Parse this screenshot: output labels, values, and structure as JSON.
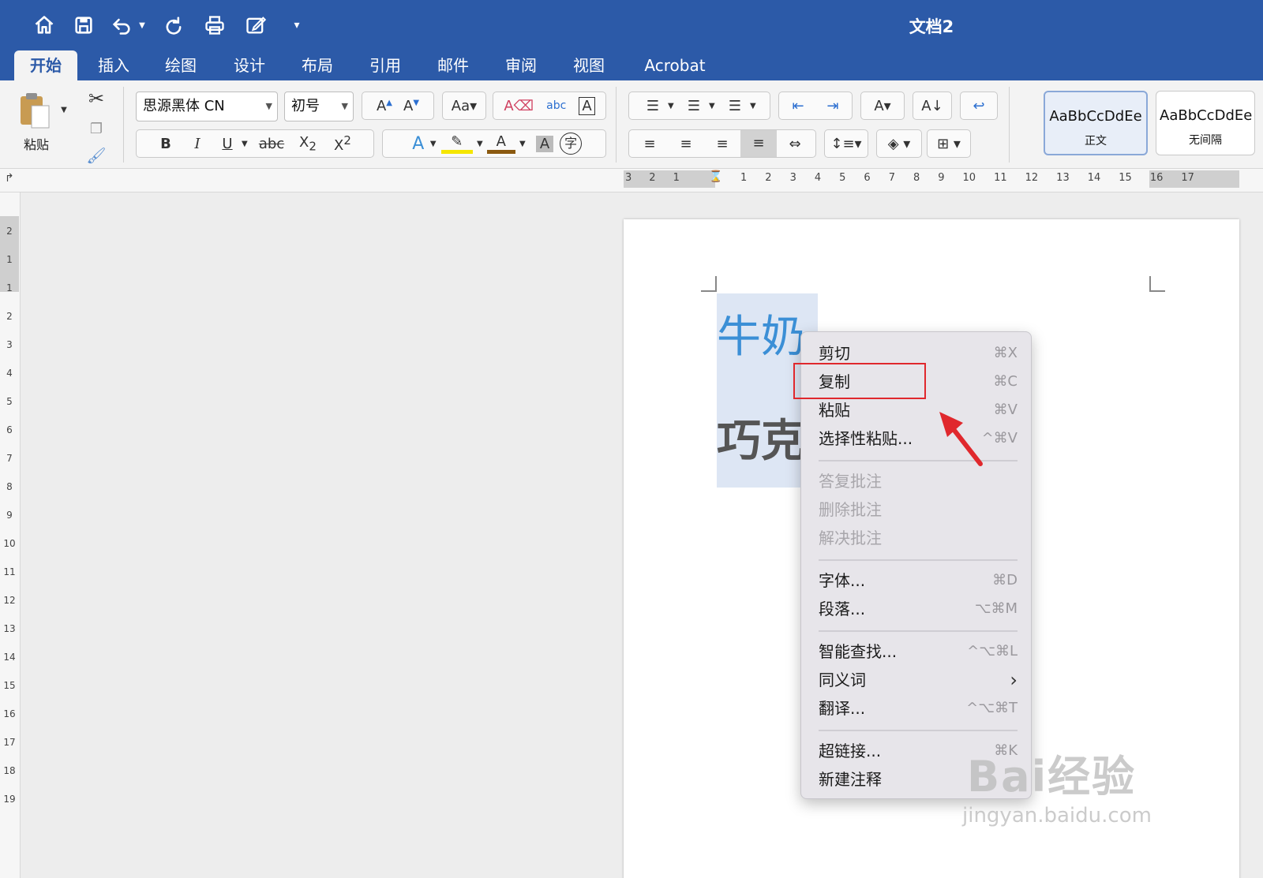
{
  "window": {
    "title": "文档2"
  },
  "tabs": [
    {
      "label": "开始",
      "active": true
    },
    {
      "label": "插入"
    },
    {
      "label": "绘图"
    },
    {
      "label": "设计"
    },
    {
      "label": "布局"
    },
    {
      "label": "引用"
    },
    {
      "label": "邮件"
    },
    {
      "label": "审阅"
    },
    {
      "label": "视图"
    },
    {
      "label": "Acrobat"
    }
  ],
  "ribbon": {
    "paste_label": "粘贴",
    "font_name": "思源黑体 CN",
    "font_size": "初号",
    "bold": "B",
    "italic": "I",
    "underline": "U",
    "strike": "abc",
    "styles": [
      {
        "sample": "AaBbCcDdEe",
        "name": "正文",
        "selected": true
      },
      {
        "sample": "AaBbCcDdEe",
        "name": "无间隔"
      }
    ]
  },
  "ruler": {
    "h_left": [
      "3",
      "2",
      "1"
    ],
    "h_right": [
      "1",
      "2",
      "3",
      "4",
      "5",
      "6",
      "7",
      "8",
      "9",
      "10",
      "11",
      "12",
      "13",
      "14",
      "15",
      "16",
      "17"
    ],
    "v": [
      "2",
      "1",
      "1",
      "2",
      "3",
      "4",
      "5",
      "6",
      "7",
      "8",
      "9",
      "10",
      "11",
      "12",
      "13",
      "14",
      "15",
      "16",
      "17",
      "18",
      "19"
    ]
  },
  "document": {
    "line1": "牛奶",
    "line2": "巧克"
  },
  "context_menu": {
    "groups": [
      [
        {
          "label": "剪切",
          "shortcut": "⌘X"
        },
        {
          "label": "复制",
          "shortcut": "⌘C",
          "highlighted": true
        },
        {
          "label": "粘贴",
          "shortcut": "⌘V"
        },
        {
          "label": "选择性粘贴...",
          "shortcut": "^⌘V"
        }
      ],
      [
        {
          "label": "答复批注",
          "disabled": true
        },
        {
          "label": "删除批注",
          "disabled": true
        },
        {
          "label": "解决批注",
          "disabled": true
        }
      ],
      [
        {
          "label": "字体...",
          "shortcut": "⌘D"
        },
        {
          "label": "段落...",
          "shortcut": "⌥⌘M"
        }
      ],
      [
        {
          "label": "智能查找...",
          "shortcut": "^⌥⌘L"
        },
        {
          "label": "同义词",
          "shortcut": "›"
        },
        {
          "label": "翻译...",
          "shortcut": "^⌥⌘T"
        }
      ],
      [
        {
          "label": "超链接...",
          "shortcut": "⌘K"
        },
        {
          "label": "新建注释"
        }
      ]
    ]
  },
  "watermark": {
    "brand": "Bai经验",
    "url": "jingyan.baidu.com"
  },
  "colors": {
    "titlebar": "#2c5aa8",
    "highlight_box": "#e0282d",
    "arrow": "#e0282d",
    "text_blue": "#3b8fd6"
  }
}
